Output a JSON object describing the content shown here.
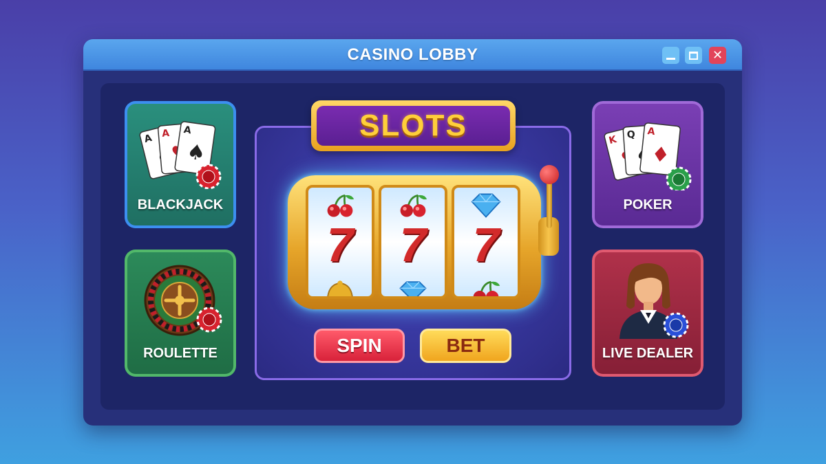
{
  "window": {
    "title": "CASINO LOBBY",
    "controls": [
      "minimize",
      "maximize",
      "close"
    ]
  },
  "games": {
    "blackjack": {
      "label": "BLACKJACK",
      "icon": "playing-cards-icon"
    },
    "roulette": {
      "label": "ROULETTE",
      "icon": "roulette-wheel-icon"
    },
    "poker": {
      "label": "POKER",
      "icon": "playing-cards-icon"
    },
    "live_dealer": {
      "label": "LIVE DEALER",
      "icon": "dealer-avatar-icon"
    }
  },
  "slots": {
    "title": "SLOTS",
    "reels": [
      {
        "top": "cherries",
        "middle": "7",
        "bottom": "bell"
      },
      {
        "top": "cherries",
        "middle": "7",
        "bottom": "diamond"
      },
      {
        "top": "diamond",
        "middle": "7",
        "bottom": "cherries"
      }
    ],
    "buttons": {
      "spin": "SPIN",
      "bet": "BET"
    }
  },
  "colors": {
    "accent": "#3f86de",
    "spin": "#d8223a",
    "bet": "#f0a51e",
    "slots_gold": "#ffcf3a"
  }
}
